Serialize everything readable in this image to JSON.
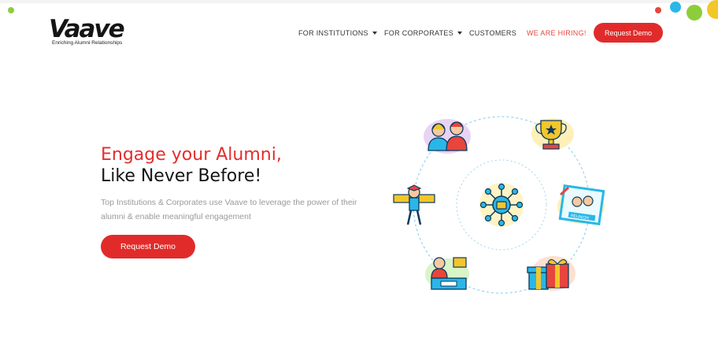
{
  "brand": {
    "name": "Vaave",
    "tagline": "Enriching Alumni Relationships"
  },
  "nav": {
    "items": [
      {
        "label": "FOR INSTITUTIONS",
        "dropdown": true
      },
      {
        "label": "FOR CORPORATES",
        "dropdown": true
      },
      {
        "label": "CUSTOMERS",
        "dropdown": false
      },
      {
        "label": "WE ARE HIRING!",
        "dropdown": false
      }
    ],
    "cta": "Request Demo"
  },
  "hero": {
    "title_line1": "Engage your Alumni,",
    "title_line2": "Like Never Before!",
    "subtitle": "Top Institutions & Corporates use Vaave to leverage the power of their alumni & enable meaningful engagement",
    "cta": "Request Demo"
  },
  "illustration": {
    "reunion_sign": "REUNION"
  },
  "colors": {
    "accent": "#e12b2b",
    "title_red": "#e52d2d",
    "hiring": "#e8453c",
    "dot_green": "#8dcd3c",
    "dot_blue": "#29b7e8",
    "dot_yellow": "#f3c62a"
  },
  "icons": [
    "caret-down-icon",
    "people-icon",
    "trophy-icon",
    "network-hub-icon",
    "graduate-icon",
    "reunion-photo-icon",
    "speaker-podium-icon",
    "gift-icon"
  ]
}
